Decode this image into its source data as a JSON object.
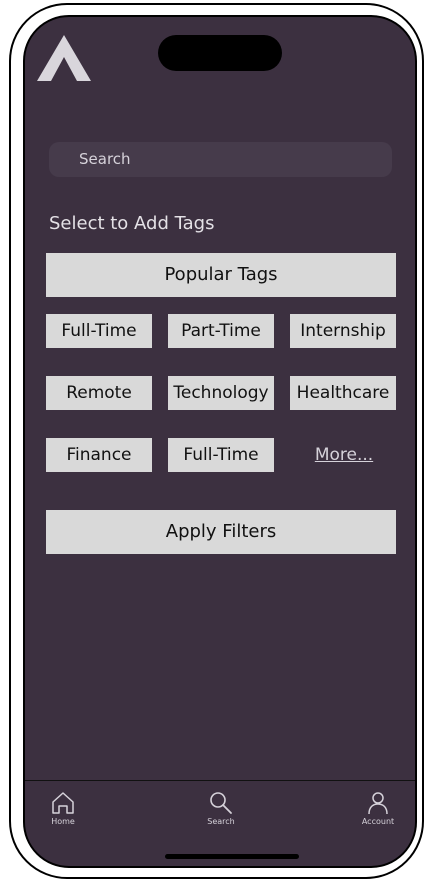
{
  "search": {
    "placeholder": "Search"
  },
  "section_label": "Select to Add Tags",
  "popular_tags_label": "Popular Tags",
  "tags": [
    "Full-Time",
    "Part-Time",
    "Internship",
    "Remote",
    "Technology",
    "Healthcare",
    "Finance",
    "Full-Time"
  ],
  "more_label": "More...",
  "apply_label": "Apply Filters",
  "nav": {
    "home": "Home",
    "search": "Search",
    "account": "Account"
  },
  "colors": {
    "screen_bg": "#3c3040",
    "button_bg": "#d9d9d9",
    "search_bg": "#463b4b"
  }
}
